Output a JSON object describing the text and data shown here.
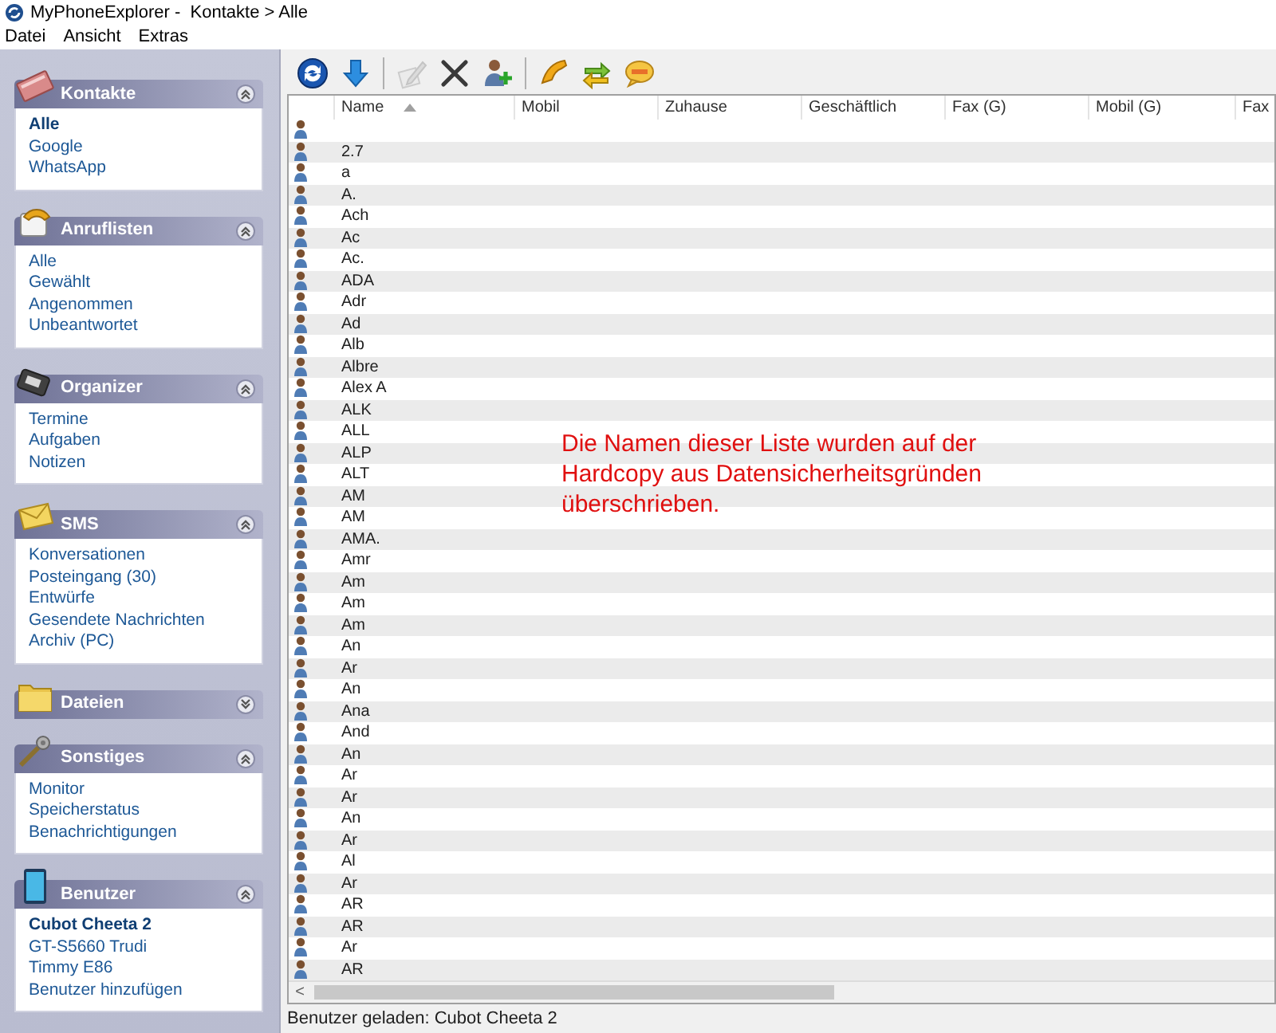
{
  "window": {
    "title": "MyPhoneExplorer -  Kontakte > Alle"
  },
  "menu": [
    "Datei",
    "Ansicht",
    "Extras"
  ],
  "sidebar": [
    {
      "kind": "contacts",
      "title": "Kontakte",
      "expanded": true,
      "items": [
        {
          "label": "Alle",
          "selected": true
        },
        {
          "label": "Google",
          "selected": false
        },
        {
          "label": "WhatsApp",
          "selected": false
        }
      ]
    },
    {
      "kind": "calls",
      "title": "Anruflisten",
      "expanded": true,
      "items": [
        {
          "label": "Alle",
          "selected": false
        },
        {
          "label": "Gewählt",
          "selected": false
        },
        {
          "label": "Angenommen",
          "selected": false
        },
        {
          "label": "Unbeantwortet",
          "selected": false
        }
      ]
    },
    {
      "kind": "organizer",
      "title": "Organizer",
      "expanded": true,
      "items": [
        {
          "label": "Termine",
          "selected": false
        },
        {
          "label": "Aufgaben",
          "selected": false
        },
        {
          "label": "Notizen",
          "selected": false
        }
      ]
    },
    {
      "kind": "sms",
      "title": "SMS",
      "expanded": true,
      "items": [
        {
          "label": "Konversationen",
          "selected": false
        },
        {
          "label": "Posteingang (30)",
          "selected": false
        },
        {
          "label": "Entwürfe",
          "selected": false
        },
        {
          "label": "Gesendete Nachrichten",
          "selected": false
        },
        {
          "label": "Archiv (PC)",
          "selected": false
        }
      ]
    },
    {
      "kind": "files",
      "title": "Dateien",
      "expanded": false
    },
    {
      "kind": "misc",
      "title": "Sonstiges",
      "expanded": true,
      "items": [
        {
          "label": "Monitor",
          "selected": false
        },
        {
          "label": "Speicherstatus",
          "selected": false
        },
        {
          "label": "Benachrichtigungen",
          "selected": false
        }
      ]
    },
    {
      "kind": "users",
      "title": "Benutzer",
      "expanded": true,
      "items": [
        {
          "label": "Cubot Cheeta 2",
          "selected": true
        },
        {
          "label": "GT-S5660 Trudi",
          "selected": false
        },
        {
          "label": "Timmy E86",
          "selected": false
        },
        {
          "label": "Benutzer hinzufügen",
          "selected": false
        }
      ]
    }
  ],
  "toolbar": [
    {
      "kind": "refresh",
      "disabled": false
    },
    {
      "kind": "download",
      "disabled": false
    },
    {
      "kind": "sep"
    },
    {
      "kind": "edit",
      "disabled": true
    },
    {
      "kind": "delete",
      "disabled": false
    },
    {
      "kind": "add-contact",
      "disabled": false
    },
    {
      "kind": "sep"
    },
    {
      "kind": "phone",
      "disabled": false
    },
    {
      "kind": "sync",
      "disabled": false
    },
    {
      "kind": "message",
      "disabled": false
    }
  ],
  "table": {
    "columns": [
      "",
      "Name",
      "Mobil",
      "Zuhause",
      "Geschäftlich",
      "Fax (G)",
      "Mobil (G)",
      "Fax"
    ],
    "rows": [
      "",
      "2.7",
      "a",
      "A.",
      "Ach",
      "Ac",
      "Ac.",
      "ADA",
      "Adr",
      "Ad",
      "Alb",
      "Albre",
      "Alex A",
      "ALK",
      "ALL",
      "ALP",
      "ALT",
      "AM",
      "AM",
      "AMA.",
      "Amr",
      "Am",
      "Am",
      "Am",
      "An",
      "Ar",
      "An",
      "Ana",
      "And",
      "An",
      "Ar",
      "Ar",
      "An",
      "Ar",
      "Al",
      "Ar",
      "AR",
      "AR",
      "Ar",
      "AR"
    ],
    "scroll_left": "<"
  },
  "note": "Die Namen dieser Liste wurden auf der\nHardcopy aus Datensicherheitsgründen\nüberschrieben.",
  "status_bar": "Benutzer geladen: Cubot Cheeta 2"
}
